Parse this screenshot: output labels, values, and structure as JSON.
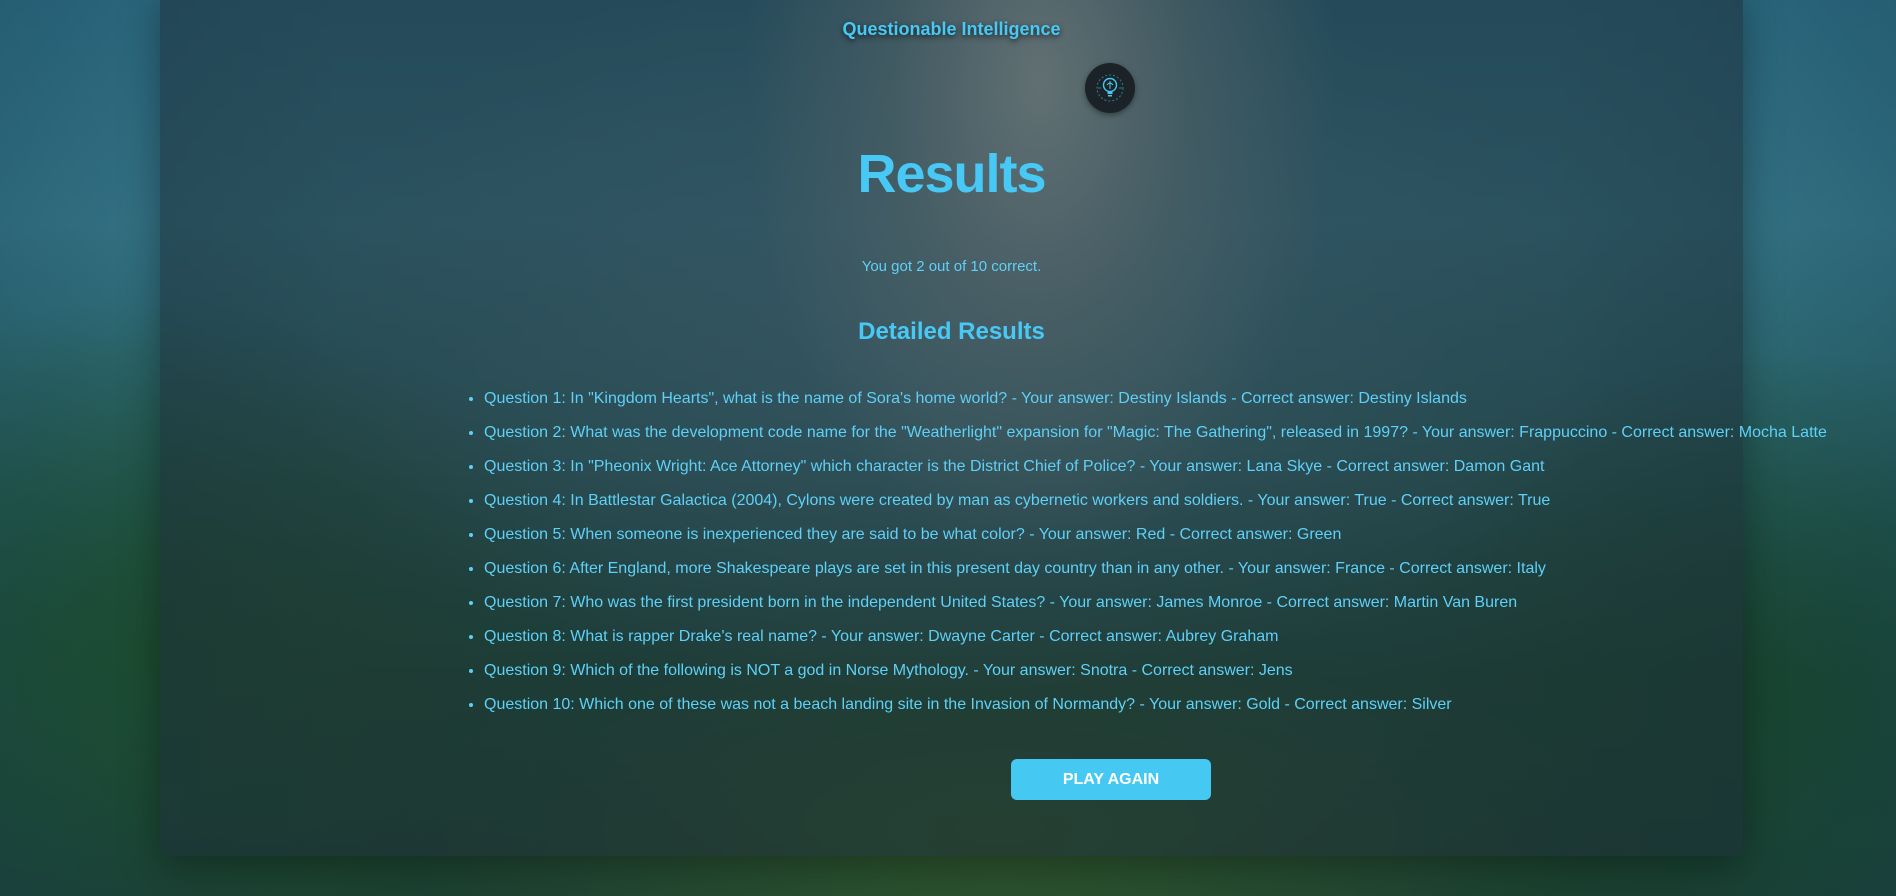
{
  "app": {
    "brand": "Questionable Intelligence",
    "logo_icon": "lightbulb-brain-icon"
  },
  "results": {
    "title": "Results",
    "score_text": "You got 2 out of 10 correct.",
    "detailed_title": "Detailed Results",
    "items": [
      "Question 1: In \"Kingdom Hearts\", what is the name of Sora's home world? - Your answer: Destiny Islands - Correct answer: Destiny Islands",
      "Question 2: What was the development code name for the \"Weatherlight\" expansion for \"Magic: The Gathering\", released in 1997? - Your answer: Frappuccino - Correct answer: Mocha Latte",
      "Question 3: In \"Pheonix Wright: Ace Attorney\" which character is the District Chief of Police? - Your answer: Lana Skye - Correct answer: Damon Gant",
      "Question 4: In Battlestar Galactica (2004), Cylons were created by man as cybernetic workers and soldiers. - Your answer: True - Correct answer: True",
      "Question 5: When someone is inexperienced they are said to be what color? - Your answer: Red - Correct answer: Green",
      "Question 6: After England, more Shakespeare plays are set in this present day country than in any other. - Your answer: France - Correct answer: Italy",
      "Question 7: Who was the first president born in the independent United States? - Your answer: James Monroe - Correct answer: Martin Van Buren",
      "Question 8: What is rapper Drake's real name? - Your answer: Dwayne Carter - Correct answer: Aubrey Graham",
      "Question 9: Which of the following is NOT a god in Norse Mythology. - Your answer: Snotra - Correct answer: Jens",
      "Question 10: Which one of these was not a beach landing site in the Invasion of Normandy? - Your answer: Gold - Correct answer: Silver"
    ],
    "play_again_label": "Play Again"
  },
  "colors": {
    "accent": "#48c8f5",
    "text": "#5fd0f7",
    "button_bg": "#45c8f2",
    "button_text": "#ffffff",
    "card_bg": "rgba(30, 45, 55, 0.55)"
  }
}
